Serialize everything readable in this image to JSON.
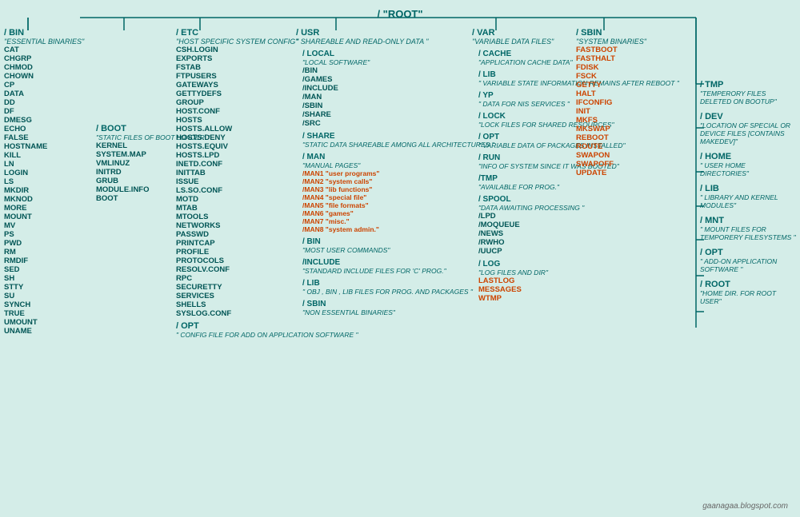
{
  "title": "/ \"ROOT\"",
  "watermark": "gaanagaa.blogspot.com",
  "columns": {
    "bin": {
      "title": "/ BIN",
      "desc": "\"ESSENTIAL BINARIES\"",
      "items": [
        "CAT",
        "CHGRP",
        "CHMOD",
        "CHOWN",
        "CP",
        "DATA",
        "DD",
        "DF",
        "DMESG",
        "ECHO",
        "FALSE",
        "HOSTNAME",
        "KILL",
        "LN",
        "LOGIN",
        "LS",
        "MKDIR",
        "MKNOD",
        "MORE",
        "MOUNT",
        "MV",
        "PS",
        "PWD",
        "RM",
        "RMDIF",
        "SED",
        "SH",
        "STTY",
        "SU",
        "SYNCH",
        "TRUE",
        "UMOUNT",
        "UNAME"
      ]
    },
    "boot": {
      "title": "/ BOOT",
      "desc": "\"STATIC FILES OF BOOT LOADER .\"",
      "items": [
        "KERNEL",
        "SYSTEM.MAP",
        "VMLINUZ",
        "INITRD",
        "GRUB",
        "MODULE.INFO",
        "BOOT"
      ]
    },
    "etc": {
      "title": "/ ETC",
      "desc": "\"HOST SPECIFIC SYSTEM CONFIG\"",
      "items": [
        "CSH.LOGIN",
        "EXPORTS",
        "FSTAB",
        "FTPUSERS",
        "GATEWAYS",
        "GETTYDEFS",
        "GROUP",
        "HOST.CONF",
        "HOSTS",
        "HOSTS.ALLOW",
        "HOSTS.DENY",
        "HOSTS.EQUIV",
        "HOSTS.LPD",
        "INETD.CONF",
        "INITTAB",
        "ISSUE",
        "LS.SO.CONF",
        "MOTD",
        "MTAB",
        "MTOOLS",
        "NETWORKS",
        "PASSWD",
        "PRINTCAP",
        "PROFILE",
        "PROTOCOLS",
        "RESOLV.CONF",
        "RPC",
        "SECURETTY",
        "SERVICES",
        "SHELLS",
        "SYSLOG.CONF"
      ],
      "opt": {
        "title": "/ OPT",
        "desc": "\" CONFIG FILE FOR ADD ON APPLICATION SOFTWARE \""
      }
    },
    "usr": {
      "title": "/ USR",
      "desc": "\" SHAREABLE AND READ-ONLY DATA \"",
      "local": {
        "title": "/ LOCAL",
        "desc": "\"LOCAL SOFTWARE\"",
        "sub": [
          "/BIN",
          "/GAMES",
          "/INCLUDE",
          "/MAN",
          "/SBIN",
          "/SHARE",
          "/SRC"
        ]
      },
      "share": {
        "title": "/ SHARE",
        "desc": "\"STATIC DATA SHAREABLE AMONG ALL ARCHITECTURES \""
      },
      "man": {
        "title": "/ MAN",
        "desc": "\"MANUAL PAGES\"",
        "items": [
          "/MAN1 \"user programs\"",
          "/MAN2 \"system calls\"",
          "/MAN3 \"lib functions\"",
          "/MAN4 \"special file\"",
          "/MAN5 \"file formats\"",
          "/MAN6 \"games\"",
          "/MAN7 \"misc.\"",
          "/MAN8 \"system admin.\""
        ]
      },
      "bin": {
        "title": "/ BIN",
        "desc": "\"MOST USER COMMANDS\""
      },
      "include": {
        "title": "/INCLUDE",
        "desc": "\"STANDARD INCLUDE FILES FOR 'C' PROG.\""
      },
      "lib": {
        "title": "/ LIB",
        "desc": "\" OBJ , BIN , LIB FILES FOR PROG. AND PACKAGES \""
      },
      "sbin": {
        "title": "/ SBIN",
        "desc": "\"NON ESSENTIAL BINARIES\""
      }
    },
    "var": {
      "title": "/ VAR",
      "desc": "\"VARIABLE DATA FILES\"",
      "cache": {
        "title": "/ CACHE",
        "desc": "\"APPLICATION CACHE DATA\""
      },
      "lib": {
        "title": "/ LIB",
        "desc": "\" VARIABLE STATE INFORMATION REMAINS AFTER REBOOT \""
      },
      "yp": {
        "title": "/ YP",
        "desc": "\" DATA FOR NIS SERVICES \""
      },
      "lock": {
        "title": "/ LOCK",
        "desc": "\"LOCK FILES FOR SHARED RESOURCES\""
      },
      "opt": {
        "title": "/ OPT",
        "desc": "\" VARIABLE DATA OF PACKAGES INSTALLED\""
      },
      "run": {
        "title": "/ RUN",
        "desc": "\"INFO OF SYSTEM SINCE IT WAS BOOTED\""
      },
      "tmp": {
        "title": "/TMP",
        "desc": "\"AVAILABLE FOR PROG.\""
      },
      "spool": {
        "title": "/ SPOOL",
        "desc": "\"DATA AWAITING PROCESSING \"",
        "sub": [
          "/LPD",
          "/MOQUEUE",
          "/NEWS",
          "/RWHO",
          "/UUCP"
        ]
      },
      "log": {
        "title": "/ LOG",
        "desc": "\"LOG FILES AND DIR\"",
        "items": [
          "LASTLOG",
          "MESSAGES",
          "WTMP"
        ]
      }
    },
    "sbin": {
      "title": "/ SBIN",
      "desc": "\"SYSTEM BINARIES\"",
      "items_orange": [
        "FASTBOOT",
        "FASTHALT",
        "FDISK",
        "FSCK",
        "GETTY",
        "HALT",
        "IFCONFIG",
        "INIT",
        "MKFS",
        "MKSWAP",
        "REBOOT",
        "ROUTE",
        "SWAPON",
        "SWAPOFF",
        "UPDATE"
      ]
    },
    "right": {
      "tmp": {
        "title": "/ TMP",
        "desc": "\"TEMPERORY FILES DELETED ON BOOTUP\""
      },
      "dev": {
        "title": "/ DEV",
        "desc": "\"LOCATION OF SPECIAL OR DEVICE FILES [CONTAINS MAKEDEV]\""
      },
      "home": {
        "title": "/ HOME",
        "desc": "\" USER HOME DIRECTORIES\""
      },
      "lib": {
        "title": "/ LIB",
        "desc": "\"  LIBRARY AND KERNEL MODULES\""
      },
      "mnt": {
        "title": "/ MNT",
        "desc": "\"  MOUNT FILES FOR TEMPORERY FILESYSTEMS \""
      },
      "opt": {
        "title": "/ OPT",
        "desc": "\" ADD-ON APPLICATION SOFTWARE \""
      },
      "root": {
        "title": "/ ROOT",
        "desc": "\"HOME DIR. FOR ROOT USER\""
      }
    }
  }
}
